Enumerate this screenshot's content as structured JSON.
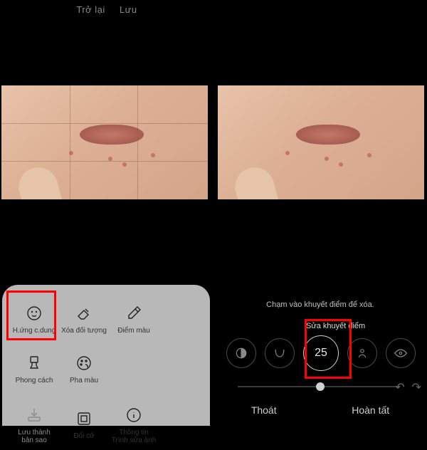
{
  "topbar": {
    "back": "Trở lại",
    "save": "Lưu"
  },
  "leftPanel": {
    "tools": [
      {
        "label": "H.ứng c.dung"
      },
      {
        "label": "Xóa đối tượng"
      },
      {
        "label": "Điểm màu"
      },
      {
        "label": "Phong cách"
      },
      {
        "label": "Pha màu"
      },
      {
        "label": "Lưu thành bản sao"
      },
      {
        "label": "Đổi cỡ"
      },
      {
        "label": "Thông tin Trình sửa ảnh"
      }
    ]
  },
  "rightPanel": {
    "hint": "Chạm vào khuyết điểm để xóa.",
    "title": "Sửa khuyết điểm",
    "sizeValue": "25",
    "exit": "Thoát",
    "done": "Hoàn tất"
  }
}
